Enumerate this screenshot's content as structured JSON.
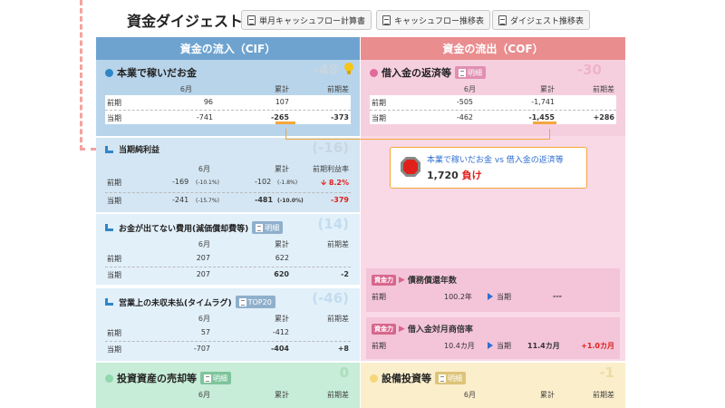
{
  "header": {
    "title": "資金ダイジェスト",
    "buttons": [
      "単月キャッシュフロー計算書",
      "キャッシュフロー推移表",
      "ダイジェスト推移表"
    ]
  },
  "columns": {
    "inflow": "資金の流入（CIF）",
    "outflow": "資金の流出（COF）"
  },
  "colors": {
    "inflow_head": "#6ea3cf",
    "outflow_head": "#e98d8f",
    "accent": "#f4a63b",
    "negative": "#e0201b",
    "badge_blue": "#3a8fd8",
    "badge_pink": "#e06a9c"
  },
  "detail_label": "明細",
  "top20_label": "TOP20",
  "table_headers": {
    "month": "6月",
    "cumulative": "累計",
    "prev_diff": "前期差",
    "prev_profit_rate": "前期利益率"
  },
  "row_labels": {
    "prev": "前期",
    "current": "当期"
  },
  "cif": {
    "business": {
      "title": "本業で稼いだお金",
      "diff": "-48",
      "prev": {
        "month": "96",
        "cum": "107"
      },
      "cur": {
        "month": "-741",
        "cum": "-265",
        "diff": "-373"
      }
    },
    "net_income": {
      "title": "当期純利益",
      "diff": "(-16)",
      "prev": {
        "month": "-169",
        "month_pct": "(-10.1%)",
        "cum": "-102",
        "cum_pct": "(-1.8%)",
        "rate": "8.2%"
      },
      "cur": {
        "month": "-241",
        "month_pct": "(-15.7%)",
        "cum": "-481",
        "cum_pct": "(-10.0%)",
        "rate": "-379"
      }
    },
    "noncash": {
      "title": "お金が出てない費用(減価償却費等)",
      "diff": "(14)",
      "prev": {
        "month": "207",
        "cum": "622"
      },
      "cur": {
        "month": "207",
        "cum": "620",
        "diff": "-2"
      }
    },
    "unpaid": {
      "title": "営業上の未収未払(タイムラグ)",
      "diff": "(-46)",
      "prev": {
        "month": "57",
        "cum": "-412"
      },
      "cur": {
        "month": "-707",
        "cum": "-404",
        "diff": "+8"
      }
    },
    "investment": {
      "title": "投資資産の売却等",
      "diff": "0"
    }
  },
  "cof": {
    "repay": {
      "title": "借入金の返済等",
      "diff": "-30",
      "prev": {
        "month": "-505",
        "cum": "-1,741"
      },
      "cur": {
        "month": "-462",
        "cum": "-1,455",
        "diff": "+286"
      }
    },
    "callout": {
      "title": "本業で稼いだお金 vs 借入金の返済等",
      "value": "1,720",
      "result": "負け"
    },
    "years": {
      "badge": "資金力",
      "title": "債務償還年数",
      "prev_label": "前期",
      "prev_value": "100.2年",
      "cur_label": "当期",
      "cur_value": "---"
    },
    "ratio": {
      "badge": "資金力",
      "title": "借入金対月商倍率",
      "prev_label": "前期",
      "prev_value": "10.4カ月",
      "cur_label": "当期",
      "cur_value": "11.4カ月",
      "diff": "+1.0カ月"
    },
    "capex": {
      "title": "設備投資等",
      "diff": "-1"
    }
  }
}
